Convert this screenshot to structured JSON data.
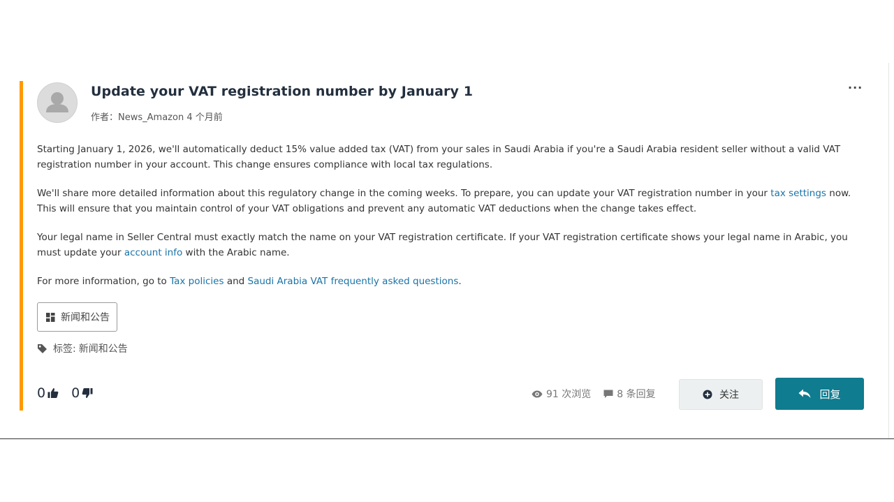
{
  "post": {
    "title": "Update your VAT registration number by January 1",
    "meta": {
      "author_prefix": "作者：",
      "author": "News_Amazon",
      "time_ago": "4 个月前"
    },
    "more_menu": "···",
    "paragraphs": {
      "p1": "Starting January 1, 2026, we'll automatically deduct 15% value added tax (VAT) from your sales in Saudi Arabia if you're a Saudi Arabia resident seller without a valid VAT registration number in your account. This change ensures compliance with local tax regulations.",
      "p2_before": "We'll share more detailed information about this regulatory change in the coming weeks. To prepare, you can update your VAT registration number in your ",
      "p2_link": "tax settings",
      "p2_after": " now. This will ensure that you maintain control of your VAT obligations and prevent any automatic VAT deductions when the change takes effect.",
      "p3_before": "Your legal name in Seller Central must exactly match the name on your VAT registration certificate. If your VAT registration certificate shows your legal name in Arabic, you must update your ",
      "p3_link": "account info",
      "p3_after": " with the Arabic name.",
      "p4_before": "For more information, go to ",
      "p4_link1": "Tax policies",
      "p4_mid": " and ",
      "p4_link2": "Saudi Arabia VAT frequently asked questions",
      "p4_after": "."
    },
    "category_button": "新闻和公告",
    "tags": {
      "label": "标签:",
      "value": "新闻和公告"
    },
    "votes": {
      "likes": "0",
      "dislikes": "0"
    },
    "stats": {
      "views": "91 次浏览",
      "replies": "8 条回复"
    },
    "follow_button": "关注",
    "reply_button": "回复"
  },
  "colors": {
    "accent": "#ff9900",
    "reply_button": "#0f7c8f",
    "link": "#1a73a8",
    "title": "#232f3e"
  },
  "icons": [
    "user-avatar-icon",
    "more-menu-icon",
    "category-grid-icon",
    "tag-icon",
    "thumbs-up-icon",
    "thumbs-down-icon",
    "eye-icon",
    "comment-icon",
    "plus-circle-icon",
    "reply-arrow-icon"
  ]
}
